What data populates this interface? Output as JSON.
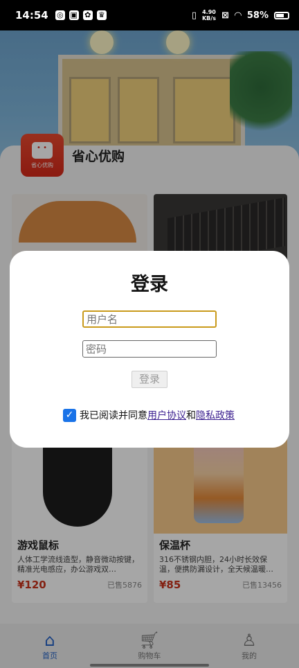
{
  "status": {
    "time": "14:54",
    "network_speed": "4.90\nKB/s",
    "battery": "58%"
  },
  "app": {
    "name": "省心优购",
    "logo_text": "省心优购"
  },
  "products": [
    {
      "name": "",
      "desc": "",
      "price": "",
      "sold": ""
    },
    {
      "name": "",
      "desc": "",
      "price": "",
      "sold": ""
    },
    {
      "name": "游戏鼠标",
      "desc": "人体工学流线造型，静音微动按键，精准光电感应，办公游戏双…",
      "price": "¥120",
      "sold": "已售5876"
    },
    {
      "name": "保温杯",
      "desc": "316不锈钢内胆，24小时长效保温，便携防漏设计，全天候温暖…",
      "price": "¥85",
      "sold": "已售13456"
    }
  ],
  "modal": {
    "title": "登录",
    "username_placeholder": "用户名",
    "password_placeholder": "密码",
    "login_button": "登录",
    "agree_prefix": "我已阅读并同意",
    "user_agreement": "用户协议",
    "and": "和",
    "privacy_policy": "隐私政策",
    "agree_checked": true
  },
  "tabbar": {
    "items": [
      {
        "label": "首页",
        "icon": "home-icon",
        "active": true
      },
      {
        "label": "购物车",
        "icon": "cart-icon",
        "active": false
      },
      {
        "label": "我的",
        "icon": "person-icon",
        "active": false
      }
    ]
  },
  "colors": {
    "accent": "#1a73e8",
    "price": "#c9321b",
    "tab_active": "#2462c6",
    "input_focus": "#c99a1b"
  }
}
